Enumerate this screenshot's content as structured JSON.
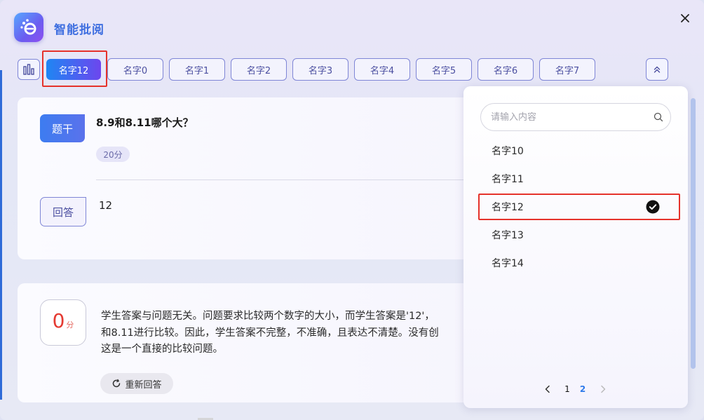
{
  "app": {
    "title": "智能批阅"
  },
  "tabs": [
    {
      "label": "名字12",
      "active": true
    },
    {
      "label": "名字0"
    },
    {
      "label": "名字1"
    },
    {
      "label": "名字2"
    },
    {
      "label": "名字3"
    },
    {
      "label": "名字4"
    },
    {
      "label": "名字5"
    },
    {
      "label": "名字6"
    },
    {
      "label": "名字7"
    }
  ],
  "question": {
    "label": "题干",
    "text": "8.9和8.11哪个大？",
    "score": "20分"
  },
  "answer": {
    "label": "回答",
    "text": "12"
  },
  "grading": {
    "score": "0",
    "unit": "分",
    "lines": [
      "学生答案与问题无关。问题要求比较两个数字的大小，而学生答案是'12'，",
      "和8.11进行比较。因此，学生答案不完整，不准确，且表达不清楚。没有创",
      "这是一个直接的比较问题。"
    ],
    "retry_label": "重新回答"
  },
  "dropdown": {
    "search_placeholder": "请输入内容",
    "items": [
      {
        "label": "名字10"
      },
      {
        "label": "名字11"
      },
      {
        "label": "名字12",
        "selected": true
      },
      {
        "label": "名字13"
      },
      {
        "label": "名字14"
      }
    ],
    "pages": [
      "1",
      "2"
    ],
    "current_page": "2"
  },
  "colors": {
    "accent_blue": "#3f6fe0",
    "active_gradient_start": "#1f86f3",
    "active_gradient_end": "#6d46ee",
    "highlight_red": "#e5322b",
    "score_red": "#e53a32"
  }
}
